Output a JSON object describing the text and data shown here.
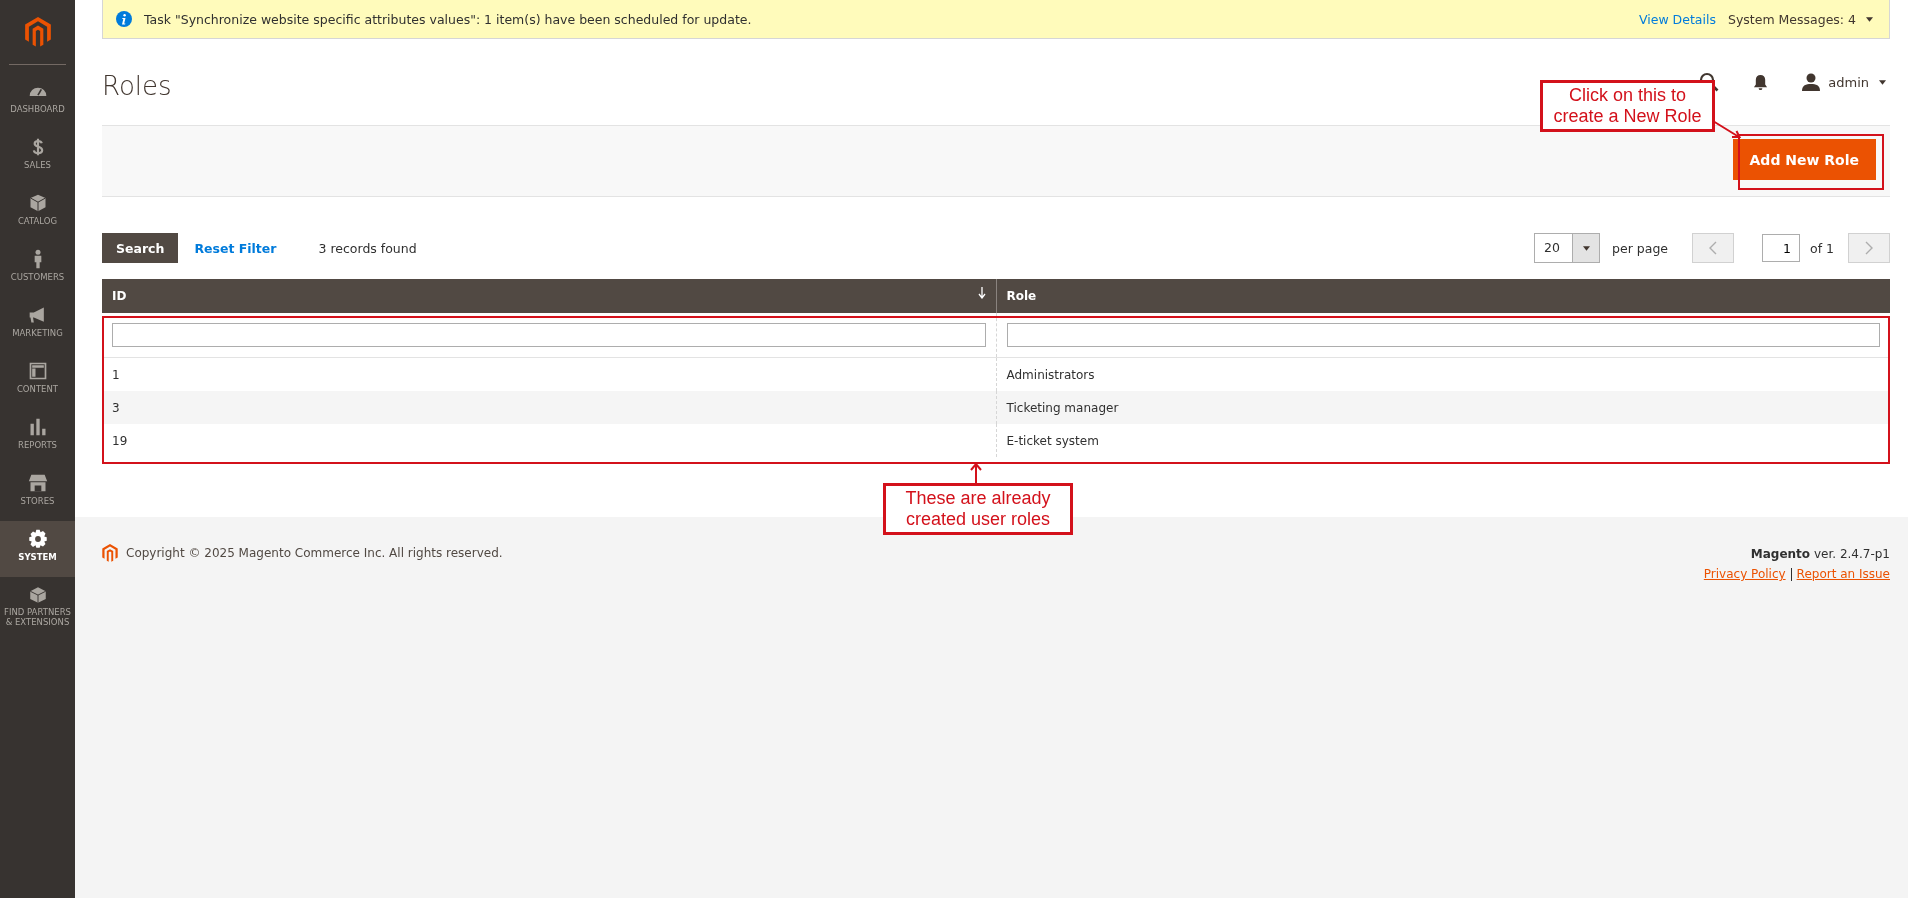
{
  "sidebar": {
    "items": [
      {
        "label": "DASHBOARD",
        "selected": false
      },
      {
        "label": "SALES",
        "selected": false
      },
      {
        "label": "CATALOG",
        "selected": false
      },
      {
        "label": "CUSTOMERS",
        "selected": false
      },
      {
        "label": "MARKETING",
        "selected": false
      },
      {
        "label": "CONTENT",
        "selected": false
      },
      {
        "label": "REPORTS",
        "selected": false
      },
      {
        "label": "STORES",
        "selected": false
      },
      {
        "label": "SYSTEM",
        "selected": true
      },
      {
        "label": "FIND PARTNERS & EXTENSIONS",
        "selected": false
      }
    ]
  },
  "notice": {
    "message": "Task \"Synchronize website specific attributes values\": 1 item(s) have been scheduled for update.",
    "link": "View Details",
    "system_messages": "System Messages: 4"
  },
  "header": {
    "title": "Roles",
    "user": "admin"
  },
  "actions": {
    "button": "Add New Role"
  },
  "toolbar": {
    "search": "Search",
    "reset": "Reset Filter",
    "records": "3 records found",
    "per_page_value": "20",
    "per_page_label": "per page",
    "page": "1",
    "of_pages": "of 1"
  },
  "table": {
    "columns": [
      {
        "label": "ID",
        "sorted": true
      },
      {
        "label": "Role",
        "sorted": false
      }
    ],
    "rows": [
      [
        "1",
        "Administrators"
      ],
      [
        "3",
        "Ticketing manager"
      ],
      [
        "19",
        "E-ticket system"
      ]
    ]
  },
  "footer": {
    "copyright": "Copyright © 2025 Magento Commerce Inc. All rights reserved.",
    "brand": "Magento",
    "version": "ver. 2.4.7-p1",
    "links": [
      "Privacy Policy",
      "Report an Issue"
    ]
  },
  "annotations": [
    {
      "text": "Click on this to create a New Role"
    },
    {
      "text": "These are already created user roles"
    }
  ]
}
